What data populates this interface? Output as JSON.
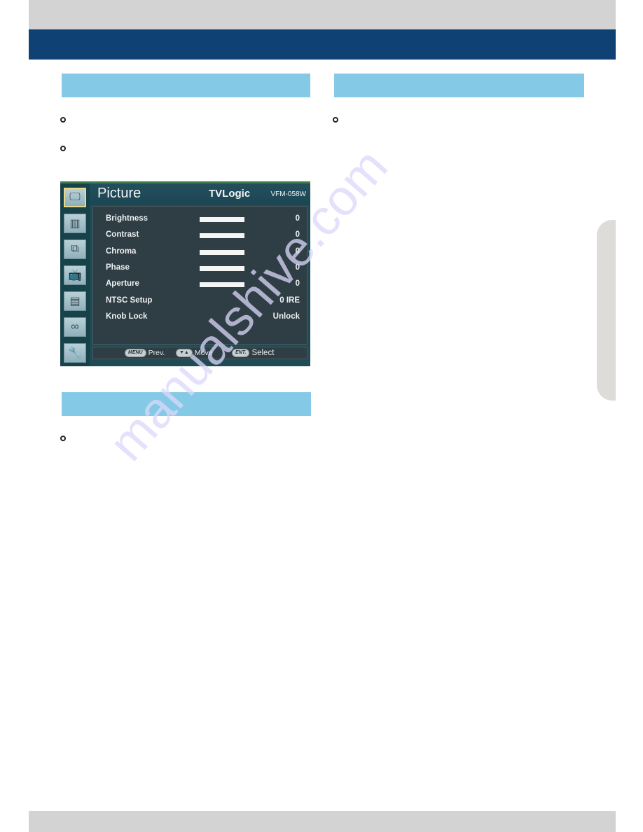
{
  "page": {
    "colors": {
      "top_band": "#d3d3d3",
      "title_band": "#0f4175",
      "section_bar": "#84c9e6",
      "side_tab": "#dedcd9",
      "osd_background": "#1f4b54",
      "osd_panel": "#2f3d44",
      "watermark": "#dcd8fb"
    },
    "watermark": "manualshive.com"
  },
  "osd": {
    "title": "Picture",
    "brand": "TVLogic",
    "model": "VFM-058W",
    "sidebar_icons": [
      {
        "name": "monitor-icon",
        "glyph": "🖵",
        "selected": true
      },
      {
        "name": "color-bars-icon",
        "glyph": "▥",
        "selected": false
      },
      {
        "name": "multi-screen-icon",
        "glyph": "⧉",
        "selected": false
      },
      {
        "name": "antenna-tv-icon",
        "glyph": "📺",
        "selected": false
      },
      {
        "name": "waveform-icon",
        "glyph": "▤",
        "selected": false
      },
      {
        "name": "speakers-icon",
        "glyph": "∞",
        "selected": false
      },
      {
        "name": "wrench-icon",
        "glyph": "🔧",
        "selected": false
      }
    ],
    "rows": [
      {
        "label": "Brightness",
        "value": "0",
        "bar_fill": 1.0
      },
      {
        "label": "Contrast",
        "value": "0",
        "bar_fill": 1.0
      },
      {
        "label": "Chroma",
        "value": "0",
        "bar_fill": 1.0
      },
      {
        "label": "Phase",
        "value": "0",
        "bar_fill": 1.0
      },
      {
        "label": "Aperture",
        "value": "0",
        "bar_fill": 1.0
      },
      {
        "label": "NTSC Setup",
        "value": "0 IRE"
      },
      {
        "label": "Knob Lock",
        "value": "Unlock"
      }
    ],
    "footer": {
      "menu_key": "MENU",
      "menu_label": "Prev.",
      "move_key": "▼▲",
      "move_label": "Move",
      "enter_key": "ENT.",
      "enter_label": "Select"
    }
  }
}
